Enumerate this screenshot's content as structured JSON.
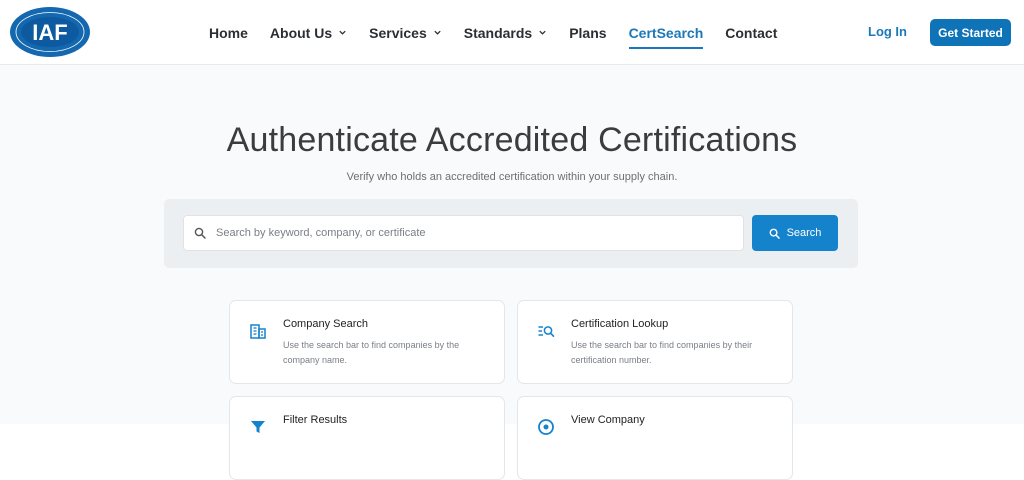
{
  "header": {
    "logo": {
      "text": "IAF",
      "ring_text": "INTERNATIONAL ACCREDITATION FORUM"
    },
    "nav": [
      {
        "label": "Home",
        "has_dropdown": false,
        "active": false
      },
      {
        "label": "About Us",
        "has_dropdown": true,
        "active": false
      },
      {
        "label": "Services",
        "has_dropdown": true,
        "active": false
      },
      {
        "label": "Standards",
        "has_dropdown": true,
        "active": false
      },
      {
        "label": "Plans",
        "has_dropdown": false,
        "active": false
      },
      {
        "label": "CertSearch",
        "has_dropdown": false,
        "active": true
      },
      {
        "label": "Contact",
        "has_dropdown": false,
        "active": false
      }
    ],
    "login_label": "Log In",
    "cta_label": "Get Started"
  },
  "hero": {
    "title": "Authenticate Accredited Certifications",
    "subtitle": "Verify who holds an accredited certification within your supply chain."
  },
  "search": {
    "placeholder": "Search by keyword, company, or certificate",
    "value": "",
    "button_label": "Search"
  },
  "cards": [
    {
      "icon": "building-icon",
      "title": "Company Search",
      "description": "Use the search bar to find companies by the company name."
    },
    {
      "icon": "list-search-icon",
      "title": "Certification Lookup",
      "description": "Use the search bar to find companies by their certification number."
    },
    {
      "icon": "filter-icon",
      "title": "Filter Results",
      "description": ""
    },
    {
      "icon": "eye-icon",
      "title": "View Company",
      "description": ""
    }
  ],
  "colors": {
    "primary": "#1b78b9",
    "button": "#0f73b8",
    "search_button": "#1583cc",
    "background": "#f9fafb",
    "panel": "#eceff2"
  }
}
